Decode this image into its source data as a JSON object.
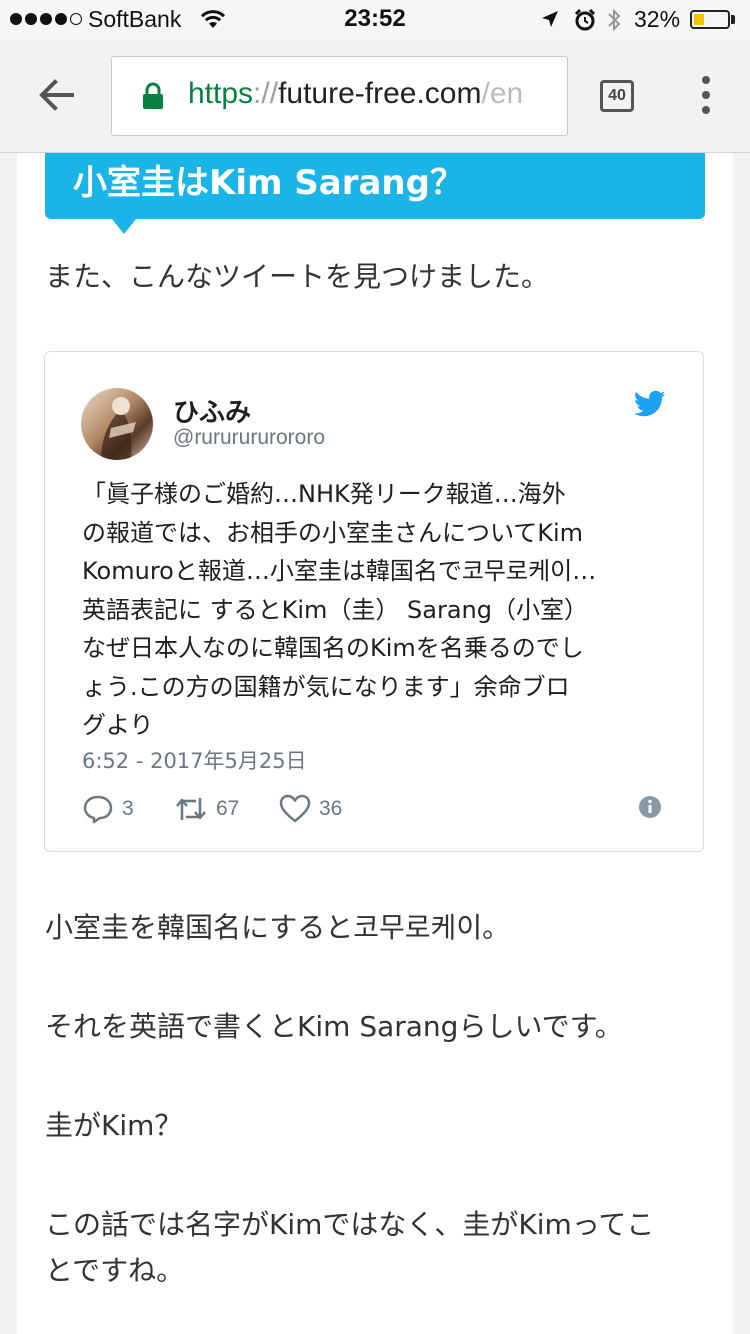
{
  "status_bar": {
    "carrier": "SoftBank",
    "time": "23:52",
    "battery_percent": "32%",
    "battery_level": 0.32,
    "signal_bars_filled": 4,
    "signal_bars_total": 5,
    "icons": [
      "wifi-icon",
      "location-arrow-icon",
      "alarm-clock-icon",
      "bluetooth-icon",
      "battery-icon"
    ]
  },
  "browser": {
    "url_scheme": "https",
    "url_separator": "://",
    "url_host": "future-free.com",
    "url_path": "/en",
    "tab_count": "40",
    "icons": [
      "back-arrow-icon",
      "lock-icon",
      "overflow-menu-icon"
    ],
    "colors": {
      "secure": "#0b8043"
    }
  },
  "article": {
    "heading": "小室圭はKim Sarang？",
    "intro": "また、こんなツイートを見つけました。",
    "paragraphs": [
      "小室圭を韓国名にすると코무로케이。",
      "それを英語で書くとKim Sarangらしいです。",
      "圭がKim？"
    ],
    "closing_lines": [
      "この話では名字がKimではなく、圭がKimってこ",
      "とですね。"
    ],
    "colors": {
      "heading_bg": "#1bb4e6"
    }
  },
  "tweet": {
    "name": "ひふみ",
    "handle": "@rururururororo",
    "text_lines": [
      "「眞子様のご婚約…NHK発リーク報道…海外",
      "の報道では、お相手の小室圭さんについてKim",
      "Komuroと報道…小室圭は韓国名で코무로케이…",
      "英語表記に するとKim（圭） Sarang（小室）",
      "なぜ日本人なのに韓国名のKimを名乗るのでし",
      "ょう.この方の国籍が気になります」余命ブロ",
      "グより"
    ],
    "date": "6:52 - 2017年5月25日",
    "replies": "3",
    "retweets": "67",
    "likes": "36",
    "icons": [
      "twitter-bird-icon",
      "reply-icon",
      "retweet-icon",
      "heart-icon",
      "info-icon"
    ],
    "colors": {
      "bird": "#1da1f2",
      "meta": "#697882"
    }
  }
}
